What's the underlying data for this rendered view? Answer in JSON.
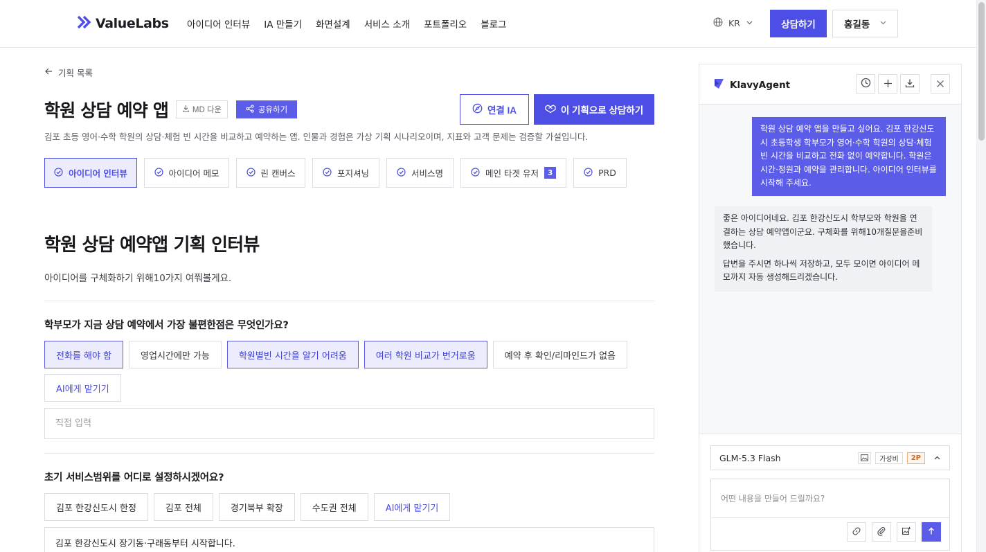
{
  "header": {
    "logo": "ValueLabs",
    "nav": [
      "아이디어 인터뷰",
      "IA 만들기",
      "화면설계",
      "서비스 소개",
      "포트폴리오",
      "블로그"
    ],
    "lang": "KR",
    "consult_label": "상담하기",
    "user_name": "홍길동"
  },
  "main": {
    "back_label": "기획 목록",
    "title": "학원 상담 예약 앱",
    "md_label": "MD 다운",
    "share_label": "공유하기",
    "ia_label": "연결 IA",
    "plan_label": "이 기획으로 상담하기",
    "description": "김포 초등 영어·수학 학원의 상담·체험 빈 시간을 비교하고 예약하는 앱. 인물과 경험은 가상 기획 시나리오이며, 지표와 고객 문제는 검증할 가설입니다.",
    "tabs": [
      {
        "label": "아이디어 인터뷰",
        "active": true
      },
      {
        "label": "아이디어 메모"
      },
      {
        "label": "린 캔버스"
      },
      {
        "label": "포지셔닝"
      },
      {
        "label": "서비스명"
      },
      {
        "label": "메인 타겟 유저",
        "badge": "3"
      },
      {
        "label": "PRD"
      }
    ],
    "section_title": "학원 상담 예약앱 기획 인터뷰",
    "section_desc": "아이디어를 구체화하기 위해10가지 여쭤볼게요.",
    "questions": [
      {
        "title": "학부모가 지금 상담 예약에서 가장 불편한점은 무엇인가요?",
        "options": [
          "전화를 해야 함",
          "영업시간에만 가능",
          "학원별빈 시간을 알기 어려움",
          "여러 학원 비교가 번거로움",
          "예약 후 확인/리마인드가 없음",
          "AI에게 맡기기"
        ],
        "input_placeholder": "직접 입력",
        "input_value": ""
      },
      {
        "title": "초기 서비스범위를 어디로 설정하시겠어요?",
        "options": [
          "김포 한강신도시 한정",
          "김포 전체",
          "경기북부 확장",
          "수도권 전체",
          "AI에게 맡기기"
        ],
        "input_placeholder": "",
        "input_value": "김포 한강신도시 장기동·구래동부터 시작합니다."
      }
    ]
  },
  "agent": {
    "name": "KlavyAgent",
    "user_message": "학원 상담 예약 앱을 만들고 싶어요. 김포 한강신도시 초등학생 학부모가 영어·수학 학원의 상담·체험 빈 시간을 비교하고 전화 없이 예약합니다. 학원은 시간·정원과 예약을 관리합니다. 아이디어 인터뷰를 시작해 주세요.",
    "bot_message_1": "좋은 아이디어네요. 김포 한강신도시 학부모와 학원을 연결하는 상담 예약앱이군요. 구체화를 위해10개질문을준비했습니다.",
    "bot_message_2": "답변을 주시면 하나씩 저장하고, 모두 모이면 아이디어 메모까지 자동 생성해드리겠습니다.",
    "model": "GLM-5.3 Flash",
    "tag_value": "가성비",
    "tag_points": "2P",
    "prompt_placeholder": "어떤 내용을 만들어 드릴까요?"
  },
  "colors": {
    "accent": "#4c4ee6",
    "accent_light": "#ececfd",
    "points": "#d8691b"
  }
}
